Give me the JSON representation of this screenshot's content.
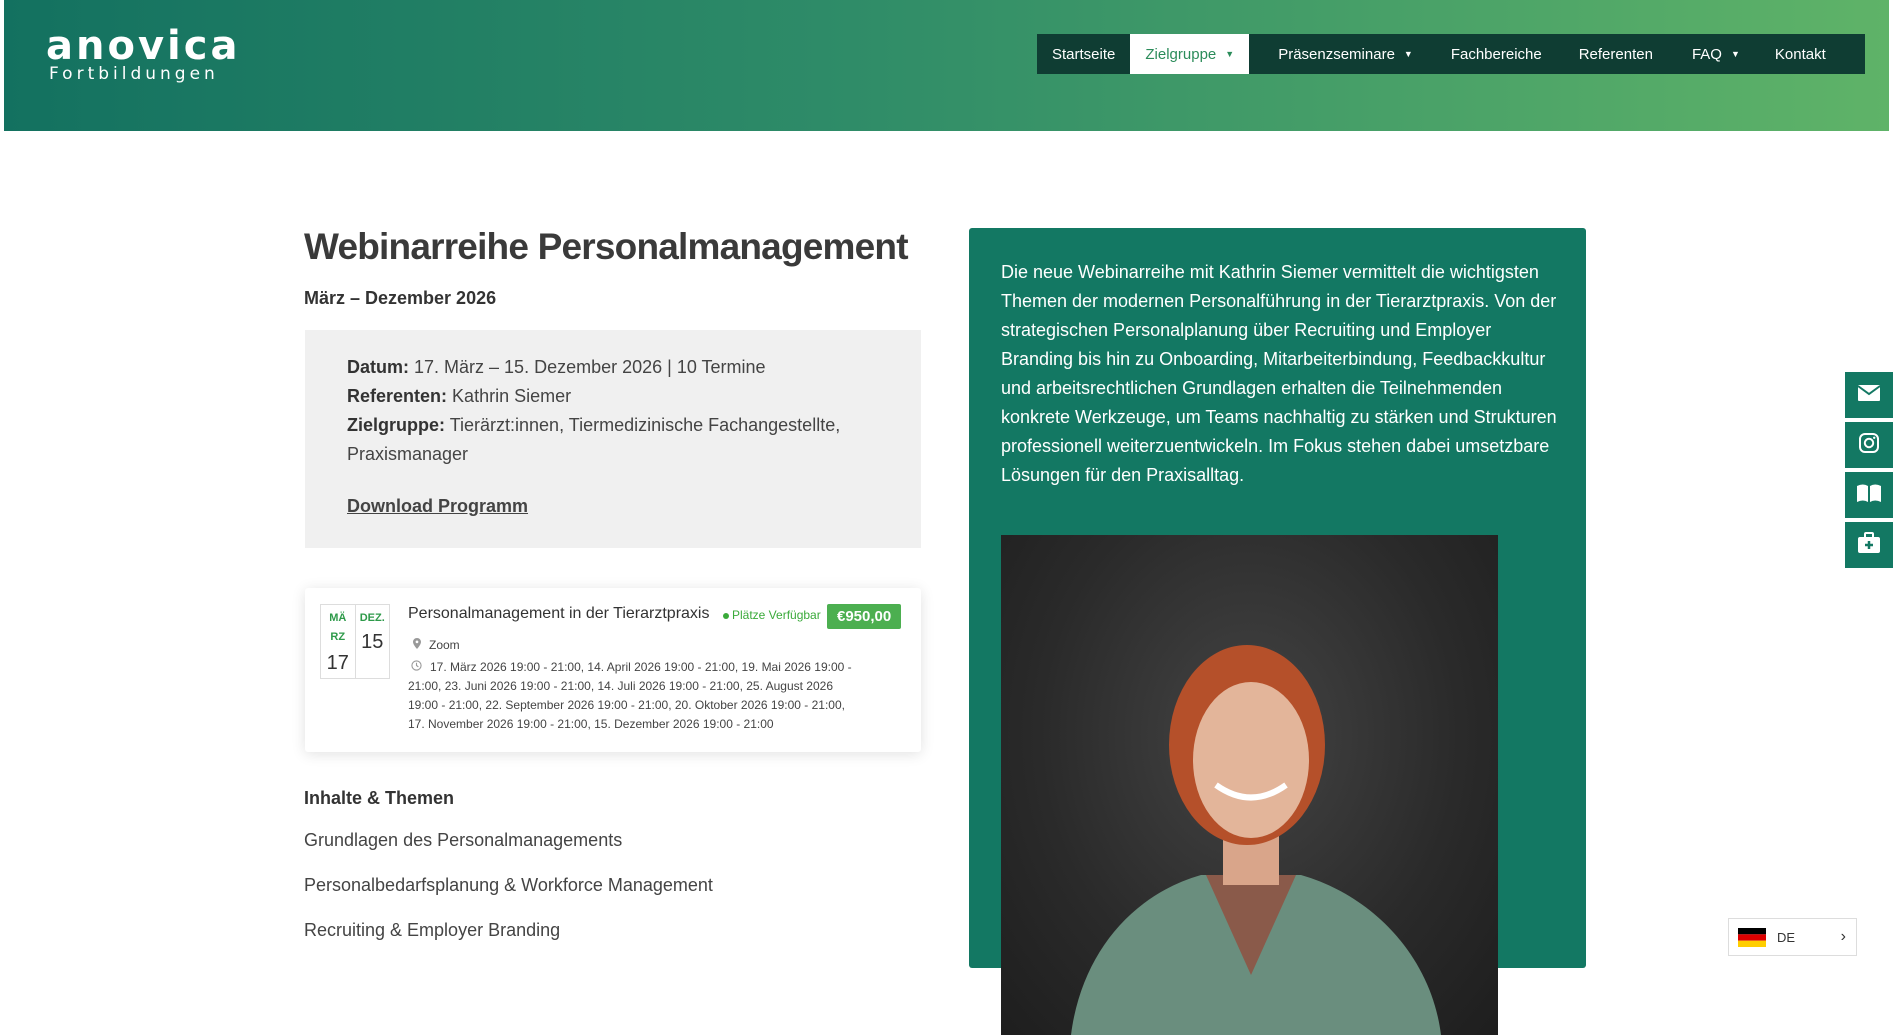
{
  "header": {
    "logo_brand": "anovica",
    "logo_sub": "Fortbildungen",
    "nav": [
      {
        "label": "Startseite"
      },
      {
        "label": "Zielgruppe",
        "dropdown": true,
        "active": true
      },
      {
        "label": "Präsenzseminare",
        "dropdown": true
      },
      {
        "label": "Fachbereiche"
      },
      {
        "label": "Referenten"
      },
      {
        "label": "FAQ",
        "dropdown": true
      },
      {
        "label": "Kontakt"
      }
    ]
  },
  "main": {
    "title": "Webinarreihe Personalmanagement",
    "subtitle": "März – Dezember 2026",
    "info": {
      "datum_label": "Datum:",
      "datum_value": "17. März – 15. Dezember 2026 | 10 Termine",
      "referenten_label": "Referenten:",
      "referenten_value": "Kathrin Siemer",
      "zielgruppe_label": "Zielgruppe:",
      "zielgruppe_value": "Tierärzt:innen, Tiermedizinische Fachangestellte, Praxismanager",
      "download": "Download Programm"
    },
    "event": {
      "start_month": "MÄRZ",
      "start_day": "17",
      "end_month": "DEZ.",
      "end_day": "15",
      "title": "Personalmanagement in der Tierarztpraxis",
      "status": "Plätze Verfügbar",
      "price": "€950,00",
      "location": "Zoom",
      "dates": "17. März 2026 19:00 - 21:00, 14. April 2026 19:00 - 21:00, 19. Mai 2026 19:00 - 21:00, 23. Juni 2026 19:00 - 21:00, 14. Juli 2026 19:00 - 21:00, 25. August 2026 19:00 - 21:00, 22. September 2026 19:00 - 21:00, 20. Oktober 2026 19:00 - 21:00, 17. November 2026 19:00 - 21:00, 15. Dezember 2026 19:00 - 21:00"
    },
    "section_title": "Inhalte & Themen",
    "topics": [
      "Grundlagen des Personalmanagements",
      "Personalbedarfsplanung & Workforce Management",
      "Recruiting & Employer Branding"
    ]
  },
  "panel": {
    "text": "Die neue Webinarreihe mit Kathrin Siemer vermittelt die wichtigsten Themen der modernen Personalführung in der Tierarztpraxis. Von der strategischen Personalplanung über Recruiting und Employer Branding bis hin zu Onboarding, Mitarbeiterbindung, Feedbackkultur und arbeitsrechtlichen Grundlagen erhalten die Teilnehmenden konkrete Werkzeuge, um Teams nachhaltig zu stärken und Strukturen professionell weiterzuentwickeln. Im Fokus stehen dabei umsetzbare Lösungen für den Praxisalltag."
  },
  "social": [
    {
      "icon": "mail-icon"
    },
    {
      "icon": "instagram-icon"
    },
    {
      "icon": "book-icon"
    },
    {
      "icon": "medical-kit-icon"
    }
  ],
  "language": {
    "code": "DE"
  }
}
